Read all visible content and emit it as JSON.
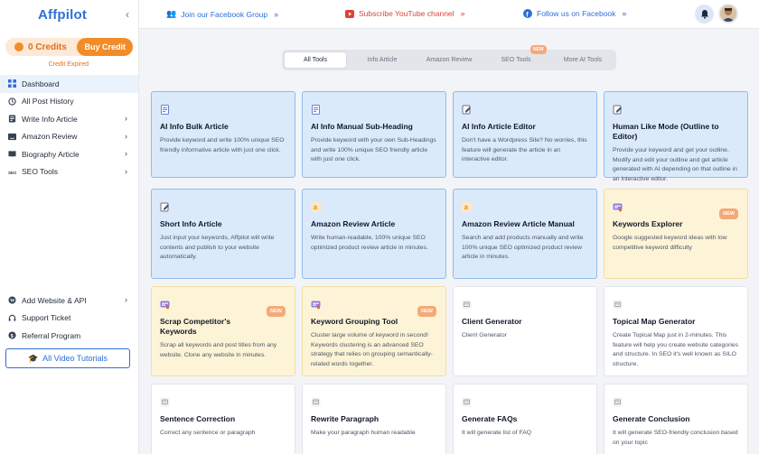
{
  "app": {
    "logo": "Affpilot"
  },
  "credits": {
    "label": "0 Credits",
    "buy_label": "Buy Credit",
    "status": "Credit Expired"
  },
  "sidebar": {
    "items": [
      {
        "label": "Dashboard",
        "icon": "grid-icon",
        "active": true,
        "chevron": false
      },
      {
        "label": "All Post History",
        "icon": "history-icon",
        "active": false,
        "chevron": false
      },
      {
        "label": "Write Info Article",
        "icon": "document-icon",
        "active": false,
        "chevron": true
      },
      {
        "label": "Amazon Review",
        "icon": "amazon-icon",
        "active": false,
        "chevron": true
      },
      {
        "label": "Biography Article",
        "icon": "book-icon",
        "active": false,
        "chevron": true
      },
      {
        "label": "SEO Tools",
        "icon": "seo-icon",
        "active": false,
        "chevron": true
      }
    ],
    "bottom_items": [
      {
        "label": "Add Website & API",
        "icon": "wordpress-icon",
        "chevron": true
      },
      {
        "label": "Support Ticket",
        "icon": "headset-icon",
        "chevron": false
      },
      {
        "label": "Referral Program",
        "icon": "dollar-icon",
        "chevron": false
      }
    ],
    "video_button": "All Video Tutorials"
  },
  "topbar": {
    "facebook_group": "Join our Facebook Group",
    "youtube": "Subscribe YouTube channel",
    "facebook_follow": "Follow us on Facebook"
  },
  "tabs": [
    "All Tools",
    "Info Article",
    "Amazon Review",
    "SEO Tools",
    "More AI Tools"
  ],
  "tab_new_badge": "NEW",
  "cards": [
    {
      "title": "AI Info Bulk Article",
      "desc": "Provide keyword and write 100% unique SEO friendly informative article with just one click.",
      "style": "blue",
      "icon": "document-icon",
      "badge": ""
    },
    {
      "title": "AI Info Manual Sub-Heading",
      "desc": "Provide keyword with your own Sub-Headings and write 100% unique SEO friendly article with just one click.",
      "style": "blue",
      "icon": "document-icon",
      "badge": ""
    },
    {
      "title": "AI Info Article Editor",
      "desc": "Don't have a Wordpress Site? No worries, this feature will generate the article in an interactive editor.",
      "style": "blue",
      "icon": "edit-document-icon",
      "badge": ""
    },
    {
      "title": "Human Like Mode (Outline to Editor)",
      "desc": "Provide your keyword and get your outline. Modify and edit your outline and get article generated with AI depending on that outline in an interactive editor.",
      "style": "blue",
      "icon": "edit-document-icon",
      "badge": ""
    },
    {
      "title": "Short Info Article",
      "desc": "Just input your keywords, Affpilot will write contents and publish to your website automatically.",
      "style": "blue",
      "icon": "edit-document-icon",
      "badge": ""
    },
    {
      "title": "Amazon Review Article",
      "desc": "Write human-readable, 100% unique SEO optimized product review article in minutes.",
      "style": "blue",
      "icon": "amazon-icon",
      "badge": ""
    },
    {
      "title": "Amazon Review Article Manual",
      "desc": "Search and add products manually and write 100% unique SEO optimized product review article in minutes.",
      "style": "blue",
      "icon": "amazon-icon",
      "badge": ""
    },
    {
      "title": "Keywords Explorer",
      "desc": "Google suggested keyword ideas with low competitive keyword difficulty",
      "style": "yellow",
      "icon": "keyword-icon",
      "badge": "NEW"
    },
    {
      "title": "Scrap Competitor's Keywords",
      "desc": "Scrap all keywords and post titles from any website. Clone any website in minutes.",
      "style": "yellow",
      "icon": "keyword-icon",
      "badge": "NEW"
    },
    {
      "title": "Keyword Grouping Tool",
      "desc": "Cluster large volume of keyword in second! Keywords clustering is an advanced SEO strategy that relies on grouping semantically-related words together.",
      "style": "yellow",
      "icon": "keyword-icon",
      "badge": "NEW"
    },
    {
      "title": "Client Generator",
      "desc": "Client Generator",
      "style": "white",
      "icon": "tool-icon",
      "badge": ""
    },
    {
      "title": "Topical Map Generator",
      "desc": "Create Topical Map just in 2-minutes. This feature will help you create website categories and structure. In SEO it's well known as SILO structure.",
      "style": "white",
      "icon": "tool-icon",
      "badge": ""
    },
    {
      "title": "Sentence Correction",
      "desc": "Correct any sentence or paragraph",
      "style": "white",
      "icon": "tool-icon",
      "badge": ""
    },
    {
      "title": "Rewrite Paragraph",
      "desc": "Make your paragraph human readable",
      "style": "white",
      "icon": "tool-icon",
      "badge": ""
    },
    {
      "title": "Generate FAQs",
      "desc": "It will generate list of FAQ",
      "style": "white",
      "icon": "tool-icon",
      "badge": ""
    },
    {
      "title": "Generate Conclusion",
      "desc": "It will generate SEO-friendly conclusion based on your topic",
      "style": "white",
      "icon": "tool-icon",
      "badge": ""
    }
  ]
}
